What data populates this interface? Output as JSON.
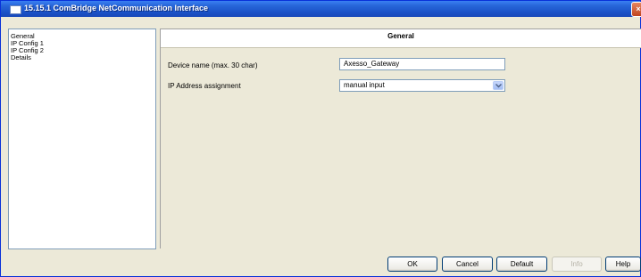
{
  "window": {
    "title": "15.15.1 ComBridge NetCommunication Interface"
  },
  "tree": {
    "items": [
      {
        "label": "General"
      },
      {
        "label": "IP Config 1"
      },
      {
        "label": "IP Config 2"
      },
      {
        "label": "Details"
      }
    ]
  },
  "panel": {
    "header": "General",
    "device_name": {
      "label": "Device name (max. 30 char)",
      "value": "Axesso_Gateway"
    },
    "ip_assignment": {
      "label": "IP Address assignment",
      "value": "manual input"
    }
  },
  "buttons": {
    "ok": "OK",
    "cancel": "Cancel",
    "default": "Default",
    "info": "Info",
    "help": "Help"
  },
  "colors": {
    "titlebar": "#2766d9",
    "window_bg": "#ece9d8",
    "field_border": "#7f9db9"
  },
  "icons": {
    "title": "window-app-icon",
    "close": "close-icon",
    "dropdown": "chevron-down-icon"
  }
}
